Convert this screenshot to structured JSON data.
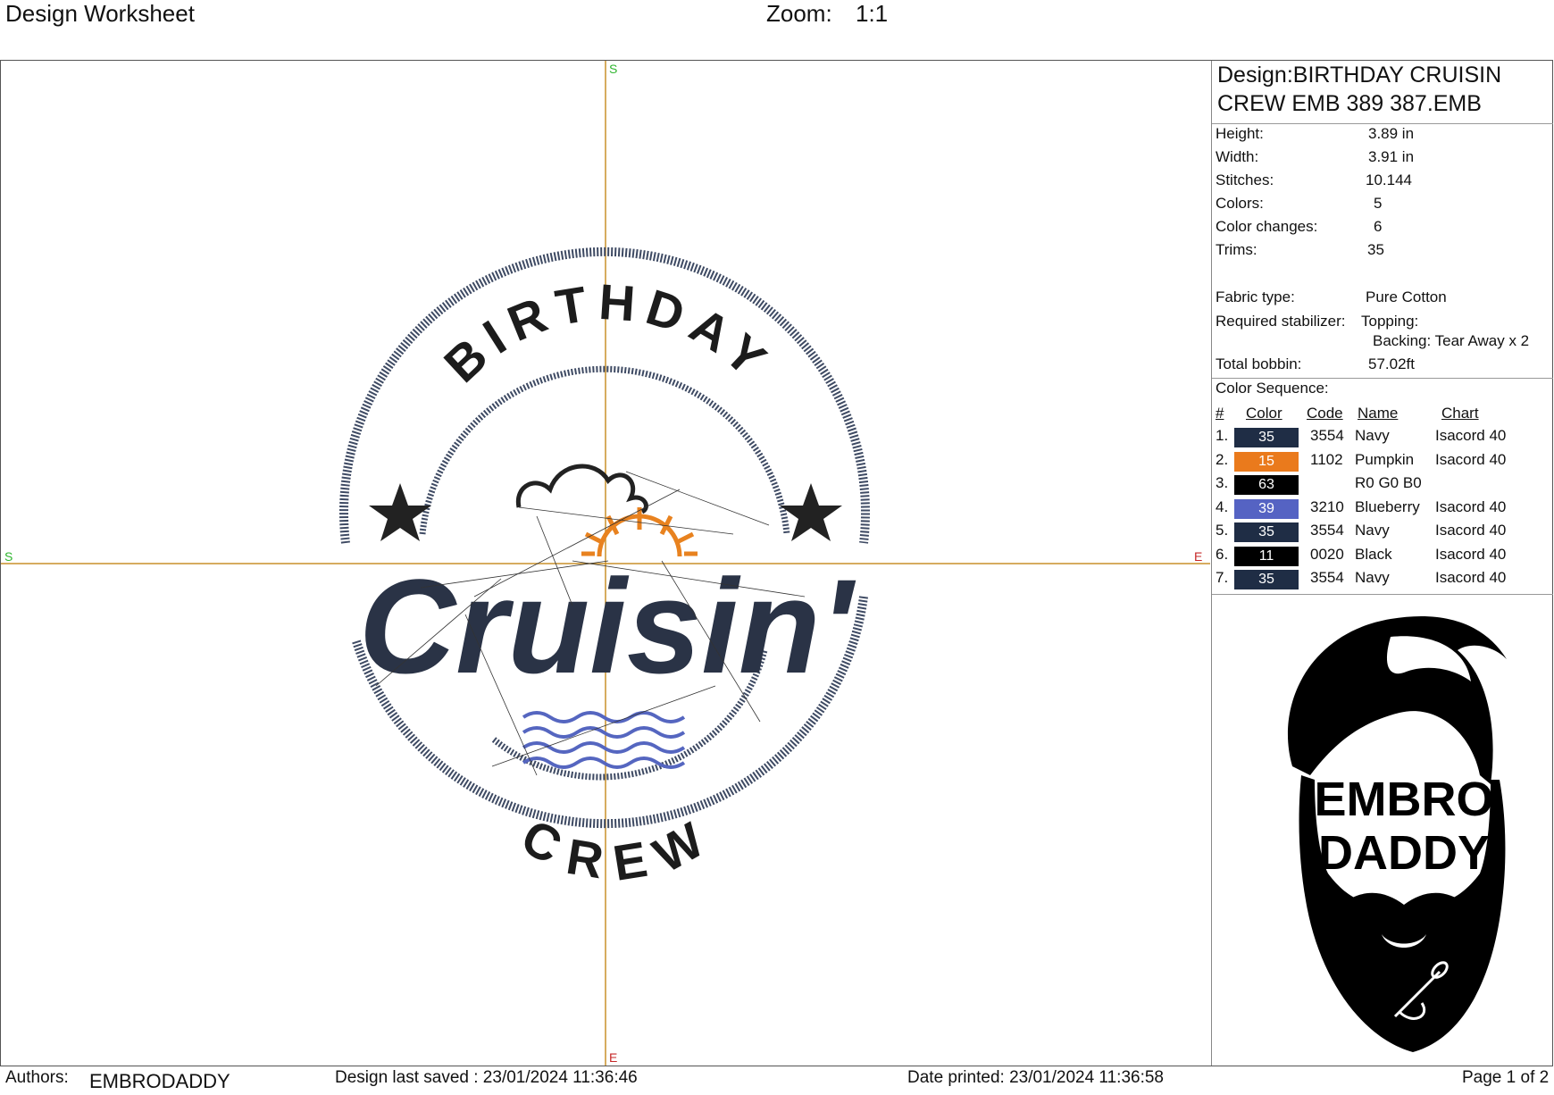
{
  "header": {
    "title": "Design Worksheet",
    "zoom_label": "Zoom:",
    "zoom_value": "1:1"
  },
  "canvas": {
    "compass": {
      "top": "S",
      "bottom": "E",
      "left": "S",
      "right": "E"
    },
    "artwork": {
      "arc_top": "BIRTHDAY",
      "script": "Cruisin'",
      "arc_bottom": "CREW"
    },
    "colors": {
      "navy": "#2a3346",
      "pumpkin": "#e8821f",
      "blueberry": "#5566c0",
      "black": "#111111",
      "crosshair": "#c8902a",
      "compass_green": "#2fb52f",
      "compass_red": "#c62828"
    }
  },
  "info": {
    "design_name_line1": "Design:BIRTHDAY CRUISIN",
    "design_name_line2": "CREW EMB 389 387.EMB",
    "height_label": "Height:",
    "height_value": "3.89 in",
    "width_label": "Width:",
    "width_value": "3.91 in",
    "stitches_label": "Stitches:",
    "stitches_value": "10.144",
    "colors_label": "Colors:",
    "colors_value": "5",
    "color_changes_label": "Color changes:",
    "color_changes_value": "6",
    "trims_label": "Trims:",
    "trims_value": "35",
    "fabric_label": "Fabric type:",
    "fabric_value": "Pure Cotton",
    "stabilizer_label": "Required stabilizer:",
    "topping": "Topping:",
    "backing": "Backing: Tear Away x 2",
    "bobbin_label": "Total bobbin:",
    "bobbin_value": "57.02ft"
  },
  "color_sequence": {
    "title": "Color Sequence:",
    "headers": {
      "num": "#",
      "color": "Color",
      "code": "Code",
      "name": "Name",
      "chart": "Chart"
    },
    "rows": [
      {
        "num": "1.",
        "swatch": "35",
        "hex": "#1f2d45",
        "code": "3554",
        "name": "Navy",
        "chart": "Isacord 40"
      },
      {
        "num": "2.",
        "swatch": "15",
        "hex": "#ea7a1c",
        "code": "1102",
        "name": "Pumpkin",
        "chart": "Isacord 40"
      },
      {
        "num": "3.",
        "swatch": "63",
        "hex": "#000000",
        "code": "",
        "name": "R0 G0 B0",
        "chart": ""
      },
      {
        "num": "4.",
        "swatch": "39",
        "hex": "#5563c3",
        "code": "3210",
        "name": "Blueberry",
        "chart": "Isacord 40"
      },
      {
        "num": "5.",
        "swatch": "35",
        "hex": "#1f2d45",
        "code": "3554",
        "name": "Navy",
        "chart": "Isacord 40"
      },
      {
        "num": "6.",
        "swatch": "11",
        "hex": "#000000",
        "code": "0020",
        "name": "Black",
        "chart": "Isacord 40"
      },
      {
        "num": "7.",
        "swatch": "35",
        "hex": "#1f2d45",
        "code": "3554",
        "name": "Navy",
        "chart": "Isacord 40"
      }
    ]
  },
  "logo": {
    "line1": "EMBRO",
    "line2": "DADDY"
  },
  "footer": {
    "authors_label": "Authors:",
    "authors_value": "EMBRODADDY",
    "saved": "Design last saved : 23/01/2024 11:36:46",
    "printed": "Date printed: 23/01/2024 11:36:58",
    "page": "Page 1 of 2"
  }
}
